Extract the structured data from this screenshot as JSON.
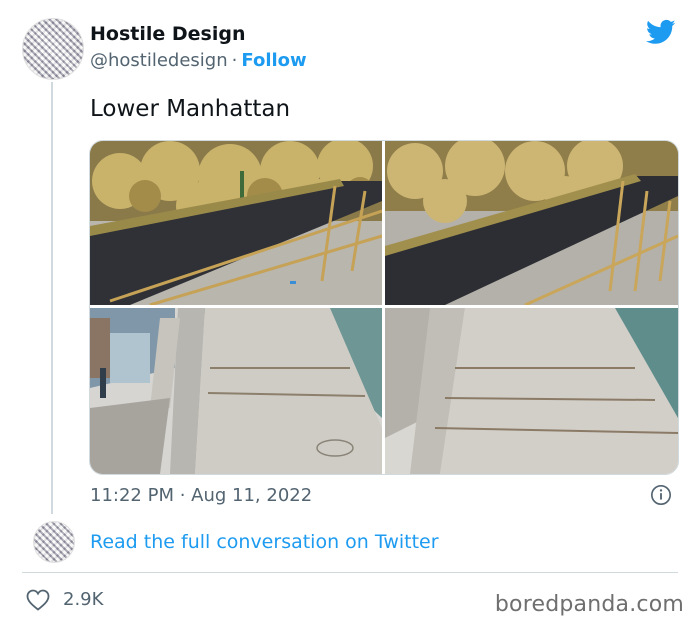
{
  "author": {
    "name": "Hostile Design",
    "handle": "@hostiledesign",
    "separator": "·",
    "follow_label": "Follow"
  },
  "tweet": {
    "text": "Lower Manhattan",
    "timestamp": "11:22 PM · Aug 11, 2022",
    "images": [
      "planter-with-spikes-1",
      "planter-with-spikes-2",
      "ledge-with-spikes-street",
      "ledge-with-spikes-closeup"
    ]
  },
  "conversation": {
    "link_label": "Read the full conversation on Twitter"
  },
  "engagement": {
    "likes": "2.9K"
  },
  "watermark": "boredpanda.com",
  "colors": {
    "accent": "#1d9bf0",
    "text": "#0f1419",
    "secondary": "#536471",
    "border": "#cfd9de"
  }
}
